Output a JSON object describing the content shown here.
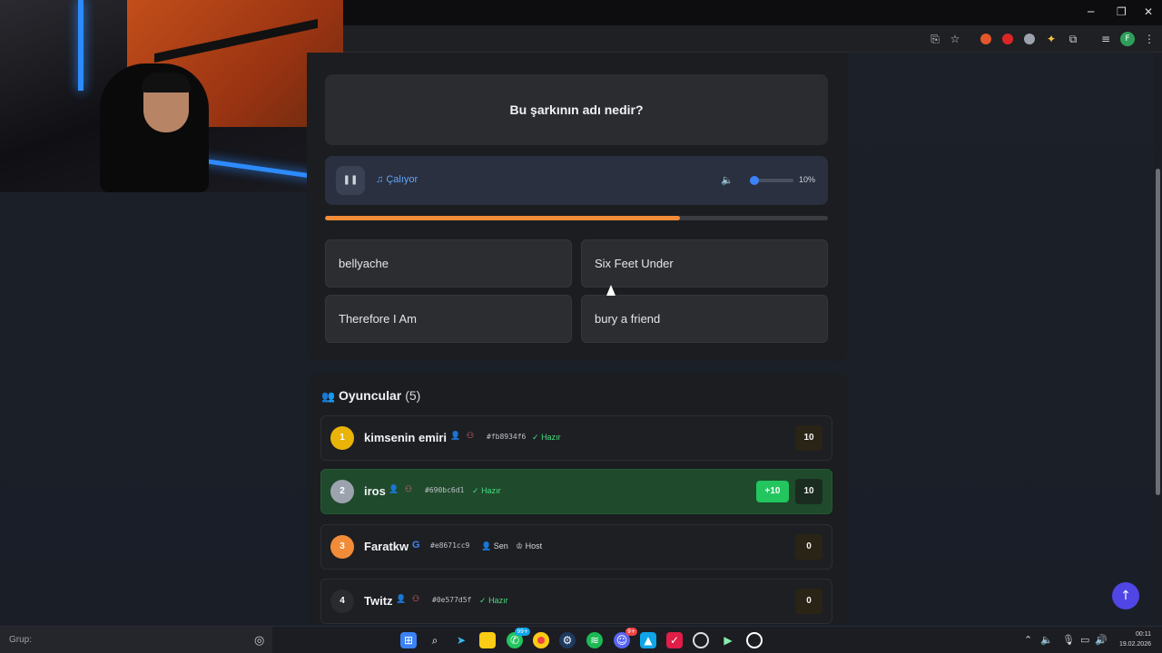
{
  "quiz": {
    "question": "Bu şarkının adı nedir?",
    "player": {
      "status_label": "Çalıyor",
      "volume_label": "10%",
      "volume_fraction": 0.1
    },
    "progress_fraction": 0.706,
    "answers": [
      "bellyache",
      "Six Feet Under",
      "Therefore I Am",
      "bury a friend"
    ]
  },
  "players_panel": {
    "title": "Oyuncular",
    "count": "(5)",
    "rows": [
      {
        "rank": "1",
        "name": "kimsenin emiri",
        "id": "#fb8934f6",
        "status": "Hazır",
        "score": "10",
        "rank_color": "#eab308"
      },
      {
        "rank": "2",
        "name": "iros",
        "id": "#690bc6d1",
        "status": "Hazır",
        "score": "10",
        "bonus": "+10",
        "rank_color": "#9ca3af"
      },
      {
        "rank": "3",
        "name": "Faratkw",
        "id": "#e8671cc9",
        "tag_you": "Sen",
        "tag_host": "Host",
        "score": "0",
        "rank_color": "#f28c38"
      },
      {
        "rank": "4",
        "name": "Twitz",
        "id": "#0e577d5f",
        "status": "Hazır",
        "score": "0",
        "rank_color": "#2a2b2f"
      }
    ]
  },
  "browser": {
    "profile_initial": "F"
  },
  "taskbar": {
    "group_label": "Grup:",
    "whatsapp_badge": "99+",
    "discord_badge": "9+",
    "time": "00:11",
    "date": "19.02.2026"
  },
  "icons": {
    "pause": "pause-icon",
    "music": "music-note-icon",
    "volume": "speaker-icon",
    "users": "users-icon",
    "user": "user-icon",
    "add_friend": "add-friend-icon",
    "check": "check-circle-icon",
    "crown": "crown-icon",
    "google": "google-icon",
    "arrow_up": "arrow-up-icon"
  }
}
